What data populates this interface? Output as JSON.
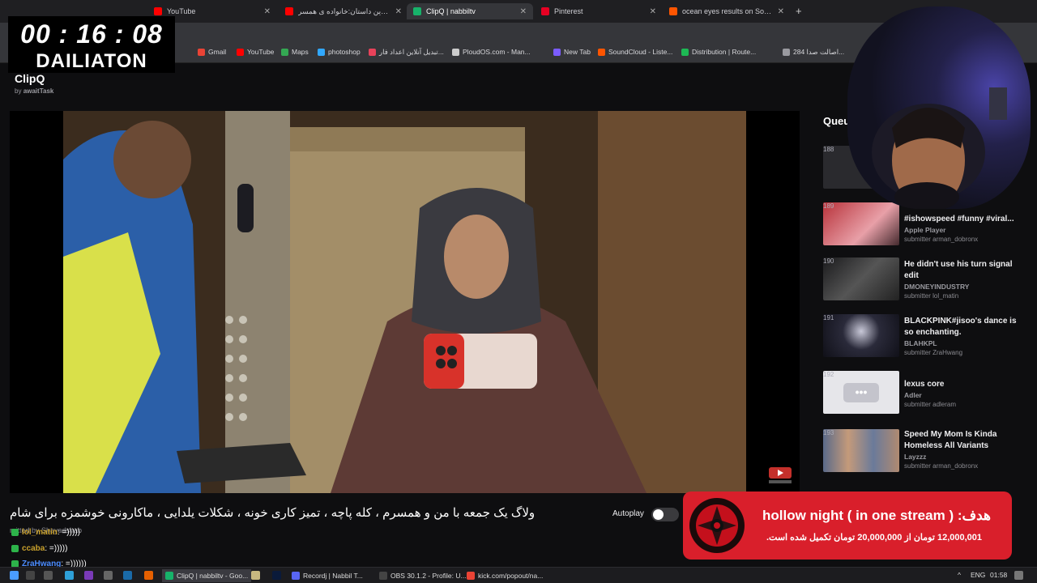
{
  "browser": {
    "tabs": [
      {
        "title": "YouTube",
        "color": "#ff0000"
      },
      {
        "title": "این داستان:خانواده ی همسر 😢",
        "color": "#ff0000"
      },
      {
        "title": "ClipQ | nabbiltv",
        "color": "#17b26a"
      },
      {
        "title": "Pinterest",
        "color": "#e60023"
      },
      {
        "title": "ocean eyes results on SoundCl",
        "color": "#ff5500"
      }
    ],
    "bookmarks": [
      {
        "label": "Gmail",
        "color": "#ea4335"
      },
      {
        "label": "YouTube",
        "color": "#ff0000"
      },
      {
        "label": "Maps",
        "color": "#34a853"
      },
      {
        "label": "photoshop",
        "color": "#31a8ff"
      },
      {
        "label": "تبدیل آنلاین اعداد فار...",
        "color": "#e8425a"
      },
      {
        "label": "PloudOS.com - Man...",
        "color": "#cccccc"
      },
      {
        "label": "New Tab",
        "color": "#7b5cff"
      },
      {
        "label": "SoundCloud - Liste...",
        "color": "#ff5500"
      },
      {
        "label": "Distribution | Route...",
        "color": "#1db954"
      },
      {
        "label": "284 اصالت صدا...",
        "color": "#9a9aa0"
      }
    ]
  },
  "timer": {
    "time": "00 : 16 : 08",
    "label": "DAILIATON"
  },
  "app": {
    "title": "ClipQ",
    "by_prefix": "by",
    "by_user": "awaitTask"
  },
  "video": {
    "caption": "ولاگ یک جمعه با من و همسرم ، کله پاچه ، تمیز کاری خونه ، شکلات یلدایی ، ماکارونی خوشمزه برای شام",
    "submitted": "mitted by Shayadshab",
    "autoplay_label": "Autoplay"
  },
  "queue": {
    "title": "Queu",
    "items": [
      {
        "num": "188",
        "title": "",
        "channel": "",
        "submitter": ""
      },
      {
        "num": "189",
        "title": "#ishowspeed #funny #viral...",
        "channel": "Apple Player",
        "submitter": "submitter arman_dobronx"
      },
      {
        "num": "190",
        "title": "He didn't use his turn signal edit",
        "channel": "DMONEYINDUSTRY",
        "submitter": "submitter lol_matin"
      },
      {
        "num": "191",
        "title": "BLACKPINK#jisoo's dance is so enchanting.",
        "channel": "BLAHKPL",
        "submitter": "submitter ZraHwang"
      },
      {
        "num": "192",
        "title": "lexus core",
        "channel": "Adler",
        "submitter": "submitter adleram"
      },
      {
        "num": "193",
        "title": "Speed My Mom Is Kinda Homeless All Variants",
        "channel": "Layzzz",
        "submitter": "submitter arman_dobronx"
      }
    ]
  },
  "goal": {
    "title": "هدف: ( hollow night ( in one stream",
    "subtitle": "12,000,001 تومان از 20,000,000 تومان تکمیل شده است."
  },
  "chat": [
    {
      "user": "lol_matin",
      "message": ": =)))))",
      "color": "#c8a02c"
    },
    {
      "user": "ccaba",
      "message": ": =)))))",
      "color": "#c8a02c"
    },
    {
      "user": "ZraHwang",
      "message": ": =))))))",
      "color": "#4b8cff"
    }
  ],
  "taskbar": {
    "apps": [
      {
        "label": "ClipQ | nabbiltv - Goo...",
        "color": "#17b26a"
      },
      {
        "label": "Recordj | Nabbil T...",
        "color": "#5865f2"
      },
      {
        "label": "OBS 30.1.2 - Profile: U...",
        "color": "#444444"
      },
      {
        "label": "kick.com/popout/na...",
        "color": "#ea4335"
      }
    ],
    "lang": "ENG",
    "clock": "01:58"
  }
}
